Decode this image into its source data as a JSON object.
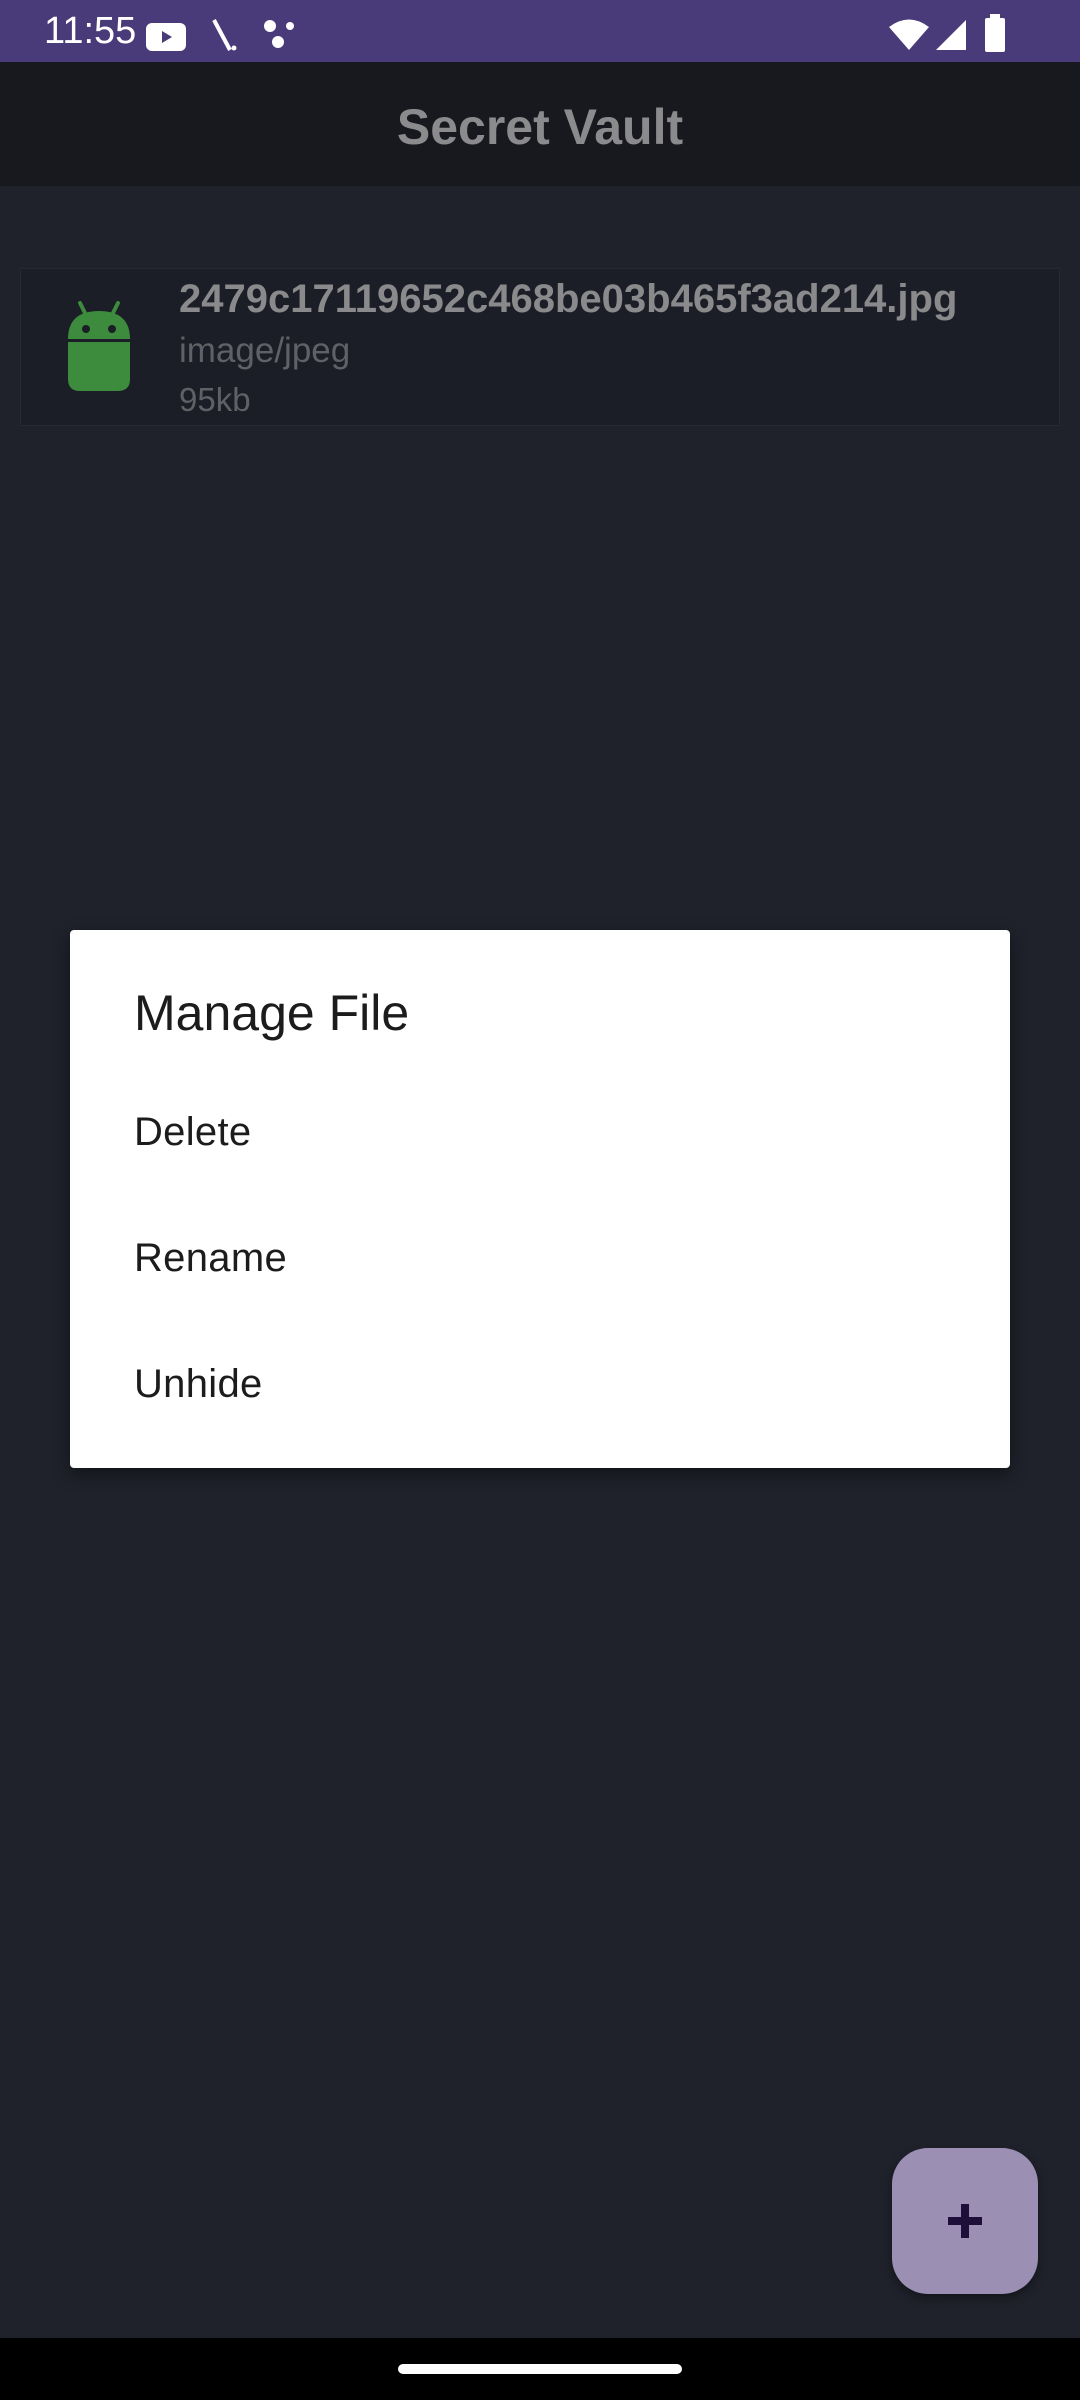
{
  "status_bar": {
    "time": "11:55",
    "icons": [
      "youtube-icon",
      "slash-icon",
      "dots-icon",
      "wifi-icon",
      "signal-icon",
      "battery-icon"
    ],
    "background": "#493a7a"
  },
  "app_bar": {
    "title": "Secret Vault"
  },
  "files": [
    {
      "name": "2479c17119652c468be03b465f3ad214.jpg",
      "type": "image/jpeg",
      "size": "95kb",
      "icon": "android-icon"
    }
  ],
  "dialog": {
    "title": "Manage File",
    "options": [
      "Delete",
      "Rename",
      "Unhide"
    ]
  },
  "fab": {
    "icon": "plus-icon",
    "color": "#9c8fb4"
  }
}
